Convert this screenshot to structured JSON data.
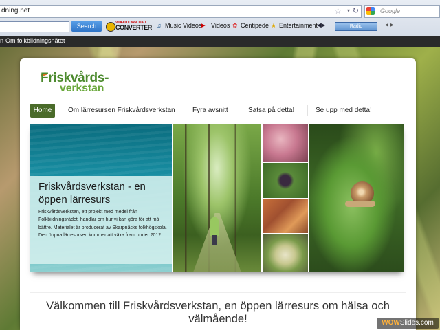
{
  "browser": {
    "url": "dning.net",
    "search_placeholder": "Google",
    "toolbar": {
      "search_button": "Search",
      "video_converter_small": "VIDEO DOWNLOAD",
      "video_converter_big": "CONVERTER",
      "music_videos": "Music Videos",
      "videos": "Videos",
      "centipede": "Centipede",
      "entertainment": "Entertainment",
      "radio": "Radio"
    },
    "bookmarks": [
      {
        "label": "n"
      },
      {
        "label": "Om folkbildningsnätet"
      }
    ]
  },
  "site": {
    "logo_line1": "Friskvårds-",
    "logo_line2": "verkstan",
    "nav": [
      {
        "label": "Home"
      },
      {
        "label": "Om lärresursen Friskvårdsverkstan"
      },
      {
        "label": "Fyra avsnitt"
      },
      {
        "label": "Satsa på detta!"
      },
      {
        "label": "Se upp med detta!"
      }
    ],
    "hero": {
      "title": "Friskvårdsverkstan - en öppen lärresurs",
      "body": "Friskvårdsverkstan, ett projekt med medel från Folkbildningsrådet, handlar om hur vi kan göra för att må bättre. Materialet är producerat av Skarpnäcks folkhögskola. Den öppna lärresursen kommer att växa fram under 2012."
    },
    "welcome": "Välkommen till Friskvårdsverkstan, en öppen lärresurs om hälsa och välmående!"
  },
  "watermark": {
    "wow": "WOW",
    "slides": "Slides",
    "tld": ".com"
  },
  "colors": {
    "nav_active": "#4a6b2a",
    "logo_green": "#4c8a2e",
    "toolbar_search": "#2f74c8"
  }
}
